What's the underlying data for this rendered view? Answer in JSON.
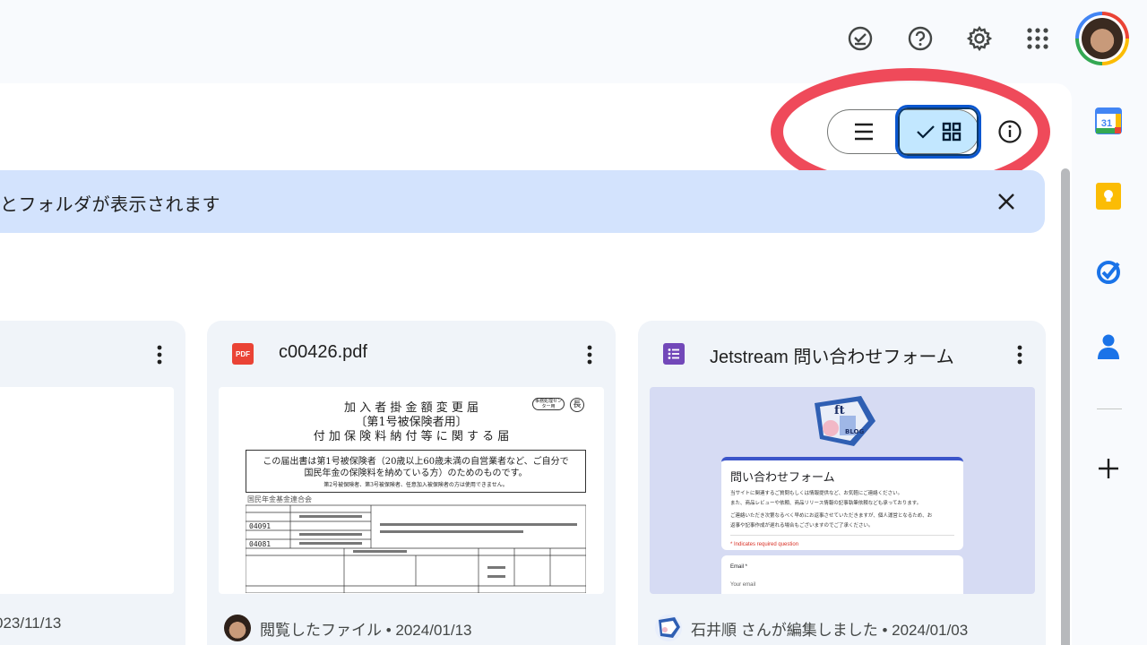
{
  "topbar": {
    "icons": [
      "ready-for-offline-icon",
      "help-icon",
      "settings-icon",
      "apps-grid-icon"
    ]
  },
  "toolbar": {
    "list_view_icon": "list-view-icon",
    "grid_view_icon": "grid-view-icon",
    "selected_view": "grid",
    "info_icon": "info-icon",
    "highlight_color": "#ef4a5a"
  },
  "banner": {
    "text": "とフォルダが表示されます"
  },
  "cards": [
    {
      "title": "",
      "meta": "023/11/13"
    },
    {
      "title": "c00426.pdf",
      "file_type_icon": "pdf-icon",
      "file_type_label": "PDF",
      "meta": "閲覧したファイル • 2024/01/13",
      "document": {
        "title_line1": "加 入 者 掛 金 額 変 更 届",
        "title_line2": "〔第1号被保険者用〕",
        "title_line3": "付 加 保 険 料 納 付 等 に 関 す る 届",
        "badge": "事務処理センター用",
        "circle": "長",
        "box_line1": "この届出書は第1号被保険者（20歳以上60歳未満の自営業者など、ご自分で",
        "box_line2": "国民年金の保険料を納めている方）のためのものです。",
        "box_note": "第2号被保険者、第3号被保険者、任意加入被保険者の方は使用できません。",
        "section": "国民年金基金連合会",
        "row1": "04091",
        "row2": "04081"
      }
    },
    {
      "title": "Jetstream 問い合わせフォーム",
      "file_type_icon": "forms-icon",
      "meta": "石井順 さんが編集しました • 2024/01/03",
      "form": {
        "title": "問い合わせフォーム",
        "desc1": "当サイトに関連するご質問もしくは情報提供など、お気軽にご連絡ください。",
        "desc2": "また、商品レビューや依頼、商品リリース情報の記事執筆依頼なども承っております。",
        "desc3": "ご連絡いただき次第なるべく早めにお返事させていただきますが、個人運営となるため、お",
        "desc4": "返事や記事作成が遅れる場合もございますのでご了承ください。",
        "required": "* Indicates required question",
        "field_label": "Email *",
        "field_placeholder": "Your email",
        "logo_text": "BLOG"
      }
    }
  ],
  "right_rail": [
    "calendar-icon",
    "keep-icon",
    "tasks-icon",
    "contacts-icon",
    "add-icon"
  ],
  "calendar_day": "31"
}
